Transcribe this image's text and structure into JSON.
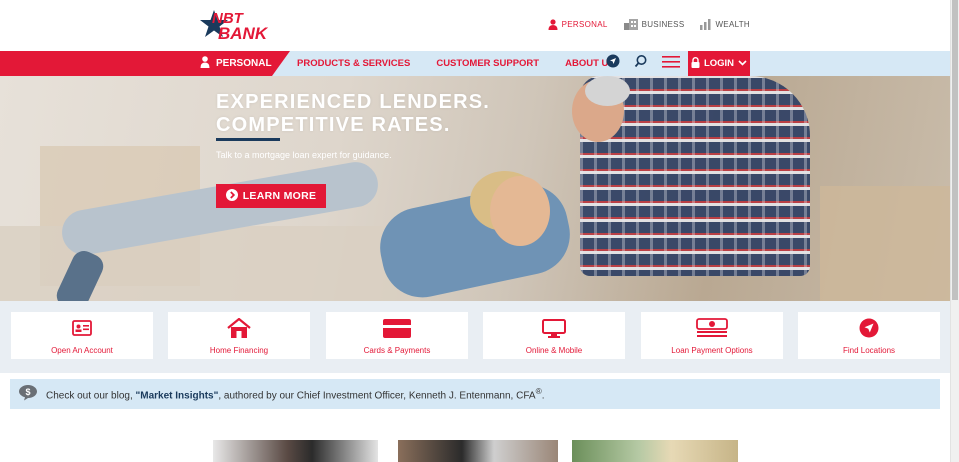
{
  "brand": {
    "logo_text": "NBT BANK",
    "primary_color": "#e31837",
    "navy_color": "#1a3a5c",
    "light_blue": "#d6e8f5"
  },
  "segments": [
    {
      "label": "PERSONAL",
      "icon": "person-icon",
      "active": true
    },
    {
      "label": "BUSINESS",
      "icon": "building-icon",
      "active": false
    },
    {
      "label": "WEALTH",
      "icon": "bar-chart-icon",
      "active": false
    }
  ],
  "nav": {
    "personal_label": "PERSONAL",
    "links": [
      "PRODUCTS & SERVICES",
      "CUSTOMER SUPPORT",
      "ABOUT US"
    ],
    "icons": [
      "location-arrow-icon",
      "search-icon",
      "menu-icon"
    ],
    "login_label": "LOGIN"
  },
  "hero": {
    "title_line1": "EXPERIENCED LENDERS.",
    "title_line2": "COMPETITIVE RATES.",
    "subtitle": "Talk to a mortgage loan expert for guidance.",
    "button_label": "LEARN MORE"
  },
  "quick_links": [
    {
      "label": "Open An Account",
      "icon": "id-card-icon"
    },
    {
      "label": "Home Financing",
      "icon": "house-icon"
    },
    {
      "label": "Cards & Payments",
      "icon": "credit-card-icon"
    },
    {
      "label": "Online & Mobile",
      "icon": "monitor-icon"
    },
    {
      "label": "Loan Payment Options",
      "icon": "money-stack-icon"
    },
    {
      "label": "Find Locations",
      "icon": "location-arrow-icon"
    }
  ],
  "blog": {
    "text_before": "Check out our blog, ",
    "title": "\"Market Insights\"",
    "text_after": ", authored by our Chief Investment Officer, Kenneth J. Entenmann, CFA",
    "superscript": "®",
    "text_end": ".",
    "icon": "chat-dollar-icon"
  }
}
